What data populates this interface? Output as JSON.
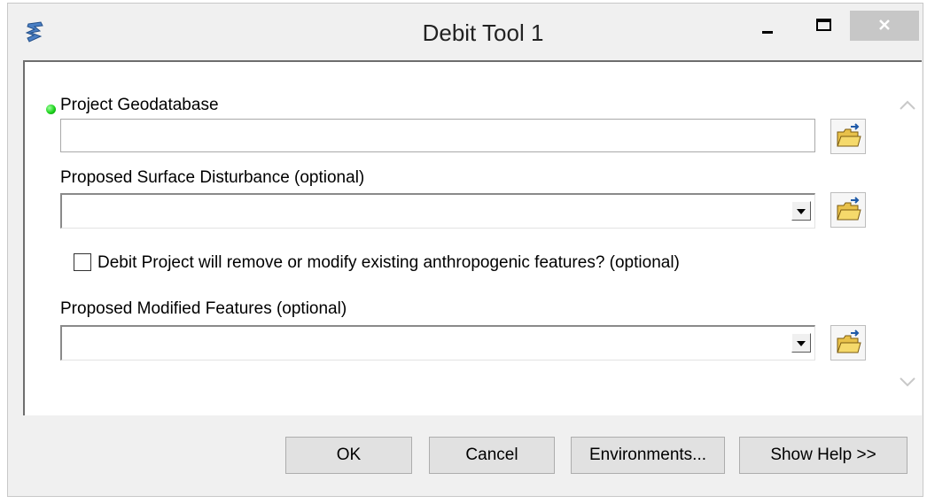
{
  "window": {
    "title": "Debit Tool 1"
  },
  "params": {
    "project_gdb": {
      "label": "Project Geodatabase",
      "value": ""
    },
    "surface_disturbance": {
      "label": "Proposed Surface Disturbance (optional)",
      "value": ""
    },
    "remove_modify_checkbox": {
      "label": "Debit Project will remove or modify existing anthropogenic features? (optional)",
      "checked": false
    },
    "modified_features": {
      "label": "Proposed Modified Features (optional)",
      "value": ""
    }
  },
  "buttons": {
    "ok": "OK",
    "cancel": "Cancel",
    "environments": "Environments...",
    "show_help": "Show Help >>"
  },
  "icons": [
    "app-icon",
    "minimize-icon",
    "maximize-icon",
    "close-icon",
    "folder-browse-icon",
    "dropdown-arrow-icon",
    "scroll-up-icon",
    "scroll-down-icon",
    "required-indicator-icon"
  ],
  "colors": {
    "required_dot": "#1cd31c",
    "folder": "#e8c14a"
  }
}
